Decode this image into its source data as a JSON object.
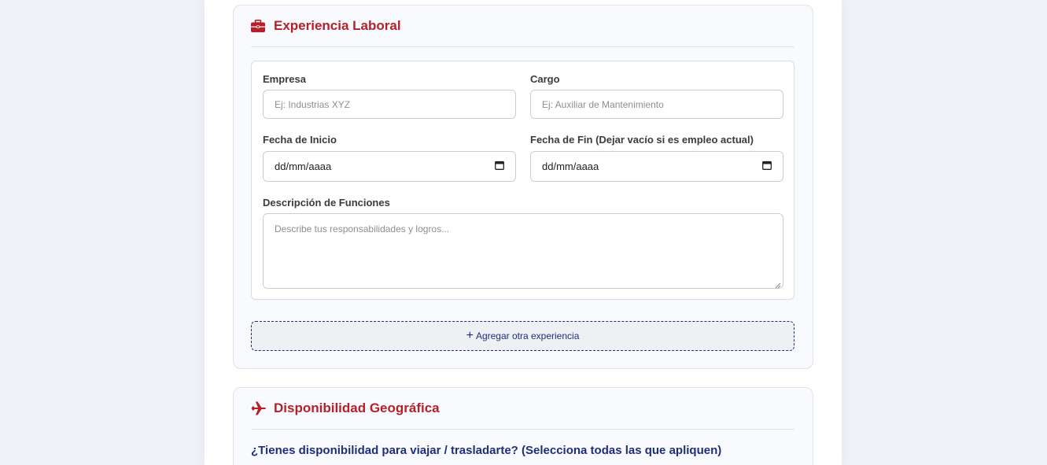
{
  "experience": {
    "title": "Experiencia Laboral",
    "icon": "briefcase-icon",
    "company_label": "Empresa",
    "company_placeholder": "Ej: Industrias XYZ",
    "position_label": "Cargo",
    "position_placeholder": "Ej: Auxiliar de Mantenimiento",
    "start_label": "Fecha de Inicio",
    "start_value": "dd/mm/aaaa",
    "end_label": "Fecha de Fin (Dejar vacío si es empleo actual)",
    "end_value": "dd/mm/aaaa",
    "description_label": "Descripción de Funciones",
    "description_placeholder": "Describe tus responsabilidades y logros...",
    "add_button_icon": "+",
    "add_button_label": "Agregar otra experiencia"
  },
  "geography": {
    "title": "Disponibilidad Geográfica",
    "icon": "plane-icon",
    "question": "¿Tienes disponibilidad para viajar / trasladarte? (Selecciona todas las que apliquen)"
  },
  "colors": {
    "accent_red": "#b5202a",
    "accent_navy": "#1d2f7a"
  }
}
